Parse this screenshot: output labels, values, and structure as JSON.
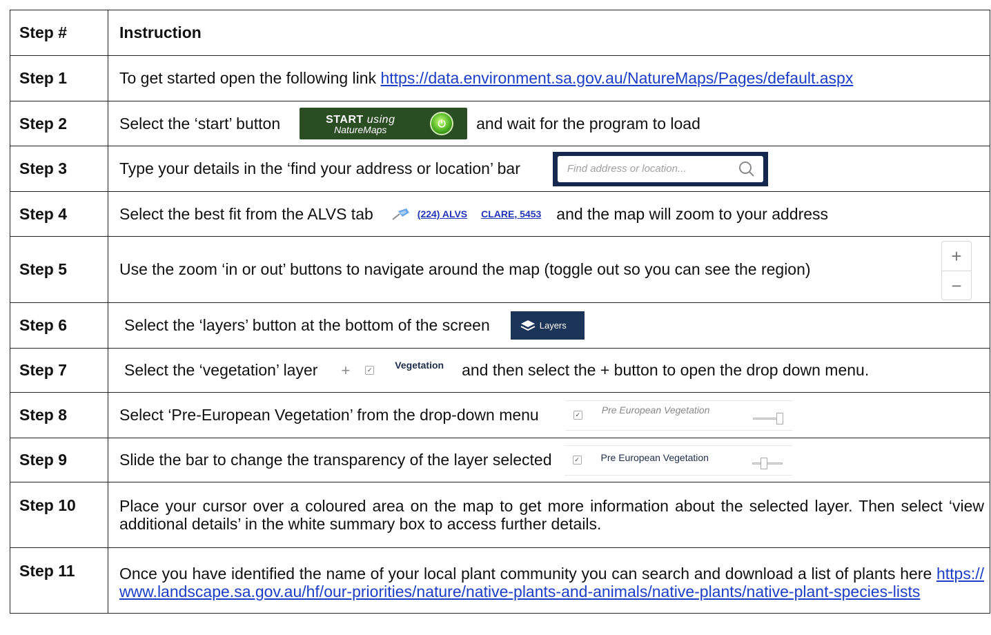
{
  "header": {
    "step_col": "Step #",
    "instruction_col": "Instruction"
  },
  "steps": [
    {
      "step": "Step 1",
      "text": "To get started open the following link",
      "link": "https://data.environment.sa.gov.au/NatureMaps/Pages/default.aspx"
    },
    {
      "step": "Step 2",
      "text_before": "Select the ‘start’ button",
      "button_main": "START",
      "button_using": "using",
      "button_sub": "NatureMaps",
      "text_after": "and wait for the program to load"
    },
    {
      "step": "Step 3",
      "text": "Type your details in the ‘find your address or location’ bar",
      "search_placeholder": "Find address or location..."
    },
    {
      "step": "Step 4",
      "text_before": "Select the best fit from the ALVS tab",
      "alvs": "(224) ALVS",
      "suburb": "CLARE, 5453",
      "text_after": "and the map will zoom to your address"
    },
    {
      "step": "Step 5",
      "text": "Use the zoom ‘in or out’ buttons to navigate around the map (toggle out so you can see the region)",
      "zoom_in": "+",
      "zoom_out": "−"
    },
    {
      "step": "Step 6",
      "text": "Select the ‘layers’ button at the bottom of the screen",
      "layers_label": "Layers"
    },
    {
      "step": "Step 7",
      "text_before": "Select the ‘vegetation’ layer",
      "plus": "+",
      "checkbox": "✓",
      "layer_label": "Vegetation",
      "text_after": "and then select the + button to open the drop down menu."
    },
    {
      "step": "Step 8",
      "text": "Select ‘Pre-European Vegetation’ from the drop-down menu",
      "layer_label": "Pre European Vegetation",
      "checkbox": "✓",
      "slider_value": 1.0
    },
    {
      "step": "Step 9",
      "text": "Slide the bar to change the transparency of the layer selected",
      "layer_label": "Pre European Vegetation",
      "checkbox": "✓",
      "slider_value": 0.35
    },
    {
      "step": "Step 10",
      "text": "Place your cursor over a coloured area on the map to get more information about the selected layer. Then select ‘view additional details’ in the white summary box to access further details."
    },
    {
      "step": "Step 11",
      "text": "Once you have identified the name of your local plant community you can search and download a list of plants here",
      "link": "https://www.landscape.sa.gov.au/hf/our-priorities/nature/native-plants-and-animals/native-plants/native-plant-species-lists"
    }
  ],
  "colors": {
    "link": "#1a3ec7",
    "start_button": "#2a4d24",
    "search_frame": "#14294d",
    "layers_button": "#1c3457"
  }
}
